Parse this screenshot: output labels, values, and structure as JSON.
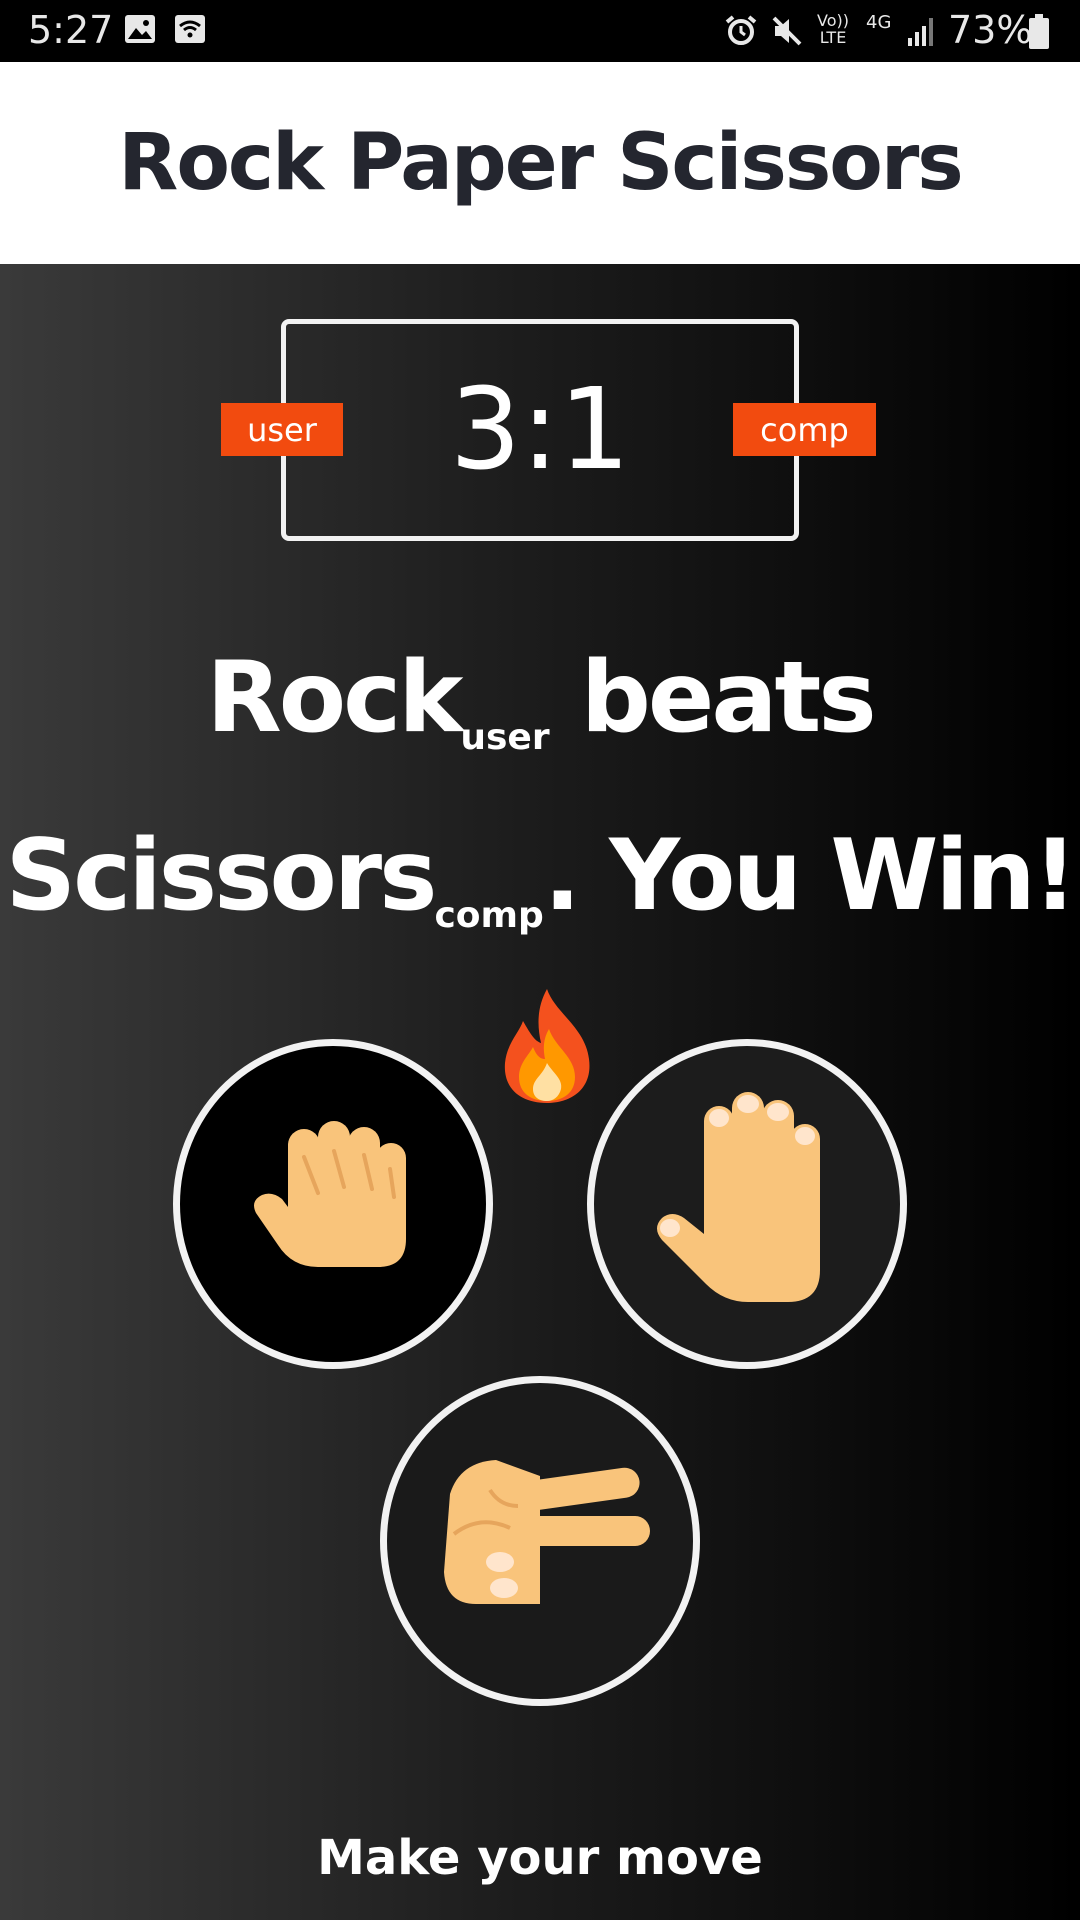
{
  "status_bar": {
    "time": "5:27",
    "battery": "73%",
    "icons": [
      "image-icon",
      "wifi-icon",
      "alarm-icon",
      "mute-icon",
      "volte-icon",
      "4g-icon",
      "signal-icon",
      "battery-icon"
    ],
    "volte_label": "Vo)) LTE",
    "network_label": "4G"
  },
  "header": {
    "title": "Rock Paper Scissors"
  },
  "score": {
    "value": "3:1",
    "user_label": "user",
    "comp_label": "comp"
  },
  "result": {
    "user_move": "Rock",
    "user_sub": "user",
    "verb": "beats",
    "comp_move": "Scissors",
    "comp_sub": "comp",
    "outcome": ". You Win!",
    "emoji": "fire-icon"
  },
  "moves": [
    {
      "name": "rock",
      "icon": "fist-icon"
    },
    {
      "name": "paper",
      "icon": "open-hand-icon"
    },
    {
      "name": "scissors",
      "icon": "victory-hand-icon"
    }
  ],
  "prompt": "Make your move",
  "colors": {
    "accent": "#f24b0f",
    "header_bg": "#ffffff",
    "title_text": "#24262f",
    "skin": "#f9c47b"
  }
}
